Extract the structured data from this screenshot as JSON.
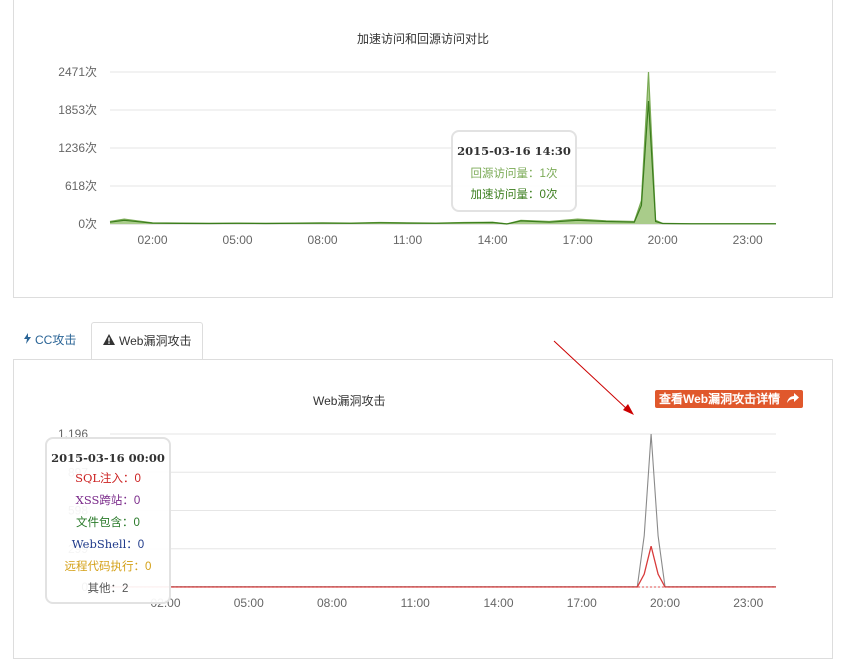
{
  "chart1": {
    "title": "加速访问和回源访问对比",
    "yticks": [
      "2471次",
      "1853次",
      "1236次",
      "618次",
      "0次"
    ],
    "xticks": [
      "02:00",
      "05:00",
      "08:00",
      "11:00",
      "14:00",
      "17:00",
      "20:00",
      "23:00"
    ],
    "colors": {
      "origin": "#7aaa55",
      "accel": "#3a7d1c",
      "fill": "#a9cc8a"
    },
    "tooltip": {
      "time": "2015-03-16 14:30",
      "origin_label": "回源访问量：1次",
      "accel_label": "加速访问量：0次"
    }
  },
  "chart_data": [
    {
      "type": "area",
      "title": "加速访问和回源访问对比",
      "xlabel": "",
      "ylabel": "",
      "ylim": [
        0,
        2471
      ],
      "x": [
        "00:30",
        "01:00",
        "02:00",
        "03:00",
        "04:00",
        "05:00",
        "06:00",
        "07:00",
        "08:00",
        "09:00",
        "10:00",
        "11:00",
        "12:00",
        "13:00",
        "14:00",
        "14:30",
        "15:00",
        "16:00",
        "17:00",
        "18:00",
        "19:00",
        "19:15",
        "19:30",
        "19:45",
        "20:00",
        "21:00",
        "22:00",
        "23:00",
        "24:00"
      ],
      "series": [
        {
          "name": "回源访问量",
          "values": [
            40,
            80,
            20,
            15,
            10,
            15,
            10,
            15,
            20,
            15,
            25,
            20,
            15,
            25,
            30,
            1,
            60,
            40,
            80,
            50,
            40,
            380,
            2471,
            60,
            10,
            5,
            5,
            5,
            5
          ]
        },
        {
          "name": "加速访问量",
          "values": [
            30,
            60,
            15,
            10,
            8,
            12,
            8,
            12,
            15,
            12,
            20,
            15,
            12,
            20,
            25,
            0,
            50,
            30,
            60,
            40,
            30,
            300,
            2000,
            40,
            8,
            4,
            4,
            4,
            4
          ]
        }
      ],
      "grid": true
    },
    {
      "type": "line",
      "title": "Web漏洞攻击",
      "xlabel": "",
      "ylabel": "",
      "ylim": [
        0,
        1196
      ],
      "x": [
        "00:00",
        "02:00",
        "05:00",
        "08:00",
        "11:00",
        "14:00",
        "17:00",
        "19:00",
        "19:15",
        "19:30",
        "19:45",
        "20:00",
        "23:00",
        "24:00"
      ],
      "series": [
        {
          "name": "其他",
          "values": [
            2,
            2,
            2,
            2,
            2,
            2,
            2,
            2,
            400,
            1196,
            400,
            2,
            2,
            2
          ]
        },
        {
          "name": "SQL注入",
          "values": [
            0,
            0,
            0,
            0,
            0,
            0,
            0,
            0,
            100,
            320,
            100,
            0,
            0,
            0
          ]
        }
      ],
      "grid": true
    }
  ],
  "tabs": {
    "cc": "CC攻击",
    "web": "Web漏洞攻击"
  },
  "chart2": {
    "title": "Web漏洞攻击",
    "detail_button": "查看Web漏洞攻击详情",
    "xticks": [
      "02:00",
      "05:00",
      "08:00",
      "11:00",
      "14:00",
      "17:00",
      "20:00",
      "23:00"
    ],
    "yticks": [
      "1,196",
      "897",
      "598",
      "299",
      "0"
    ],
    "tooltip": {
      "time": "2015-03-16 00:00",
      "rows": [
        {
          "label": "SQL注入：",
          "value": "0",
          "color": "#cc2222"
        },
        {
          "label": "XSS跨站：",
          "value": "0",
          "color": "#7a2a8a"
        },
        {
          "label": "文件包含：",
          "value": "0",
          "color": "#2a7a2a"
        },
        {
          "label": "WebShell：",
          "value": "0",
          "color": "#1f3a8a"
        },
        {
          "label": "远程代码执行：",
          "value": "0",
          "color": "#d4a017"
        },
        {
          "label": "其他：",
          "value": "2",
          "color": "#555555"
        }
      ]
    }
  }
}
